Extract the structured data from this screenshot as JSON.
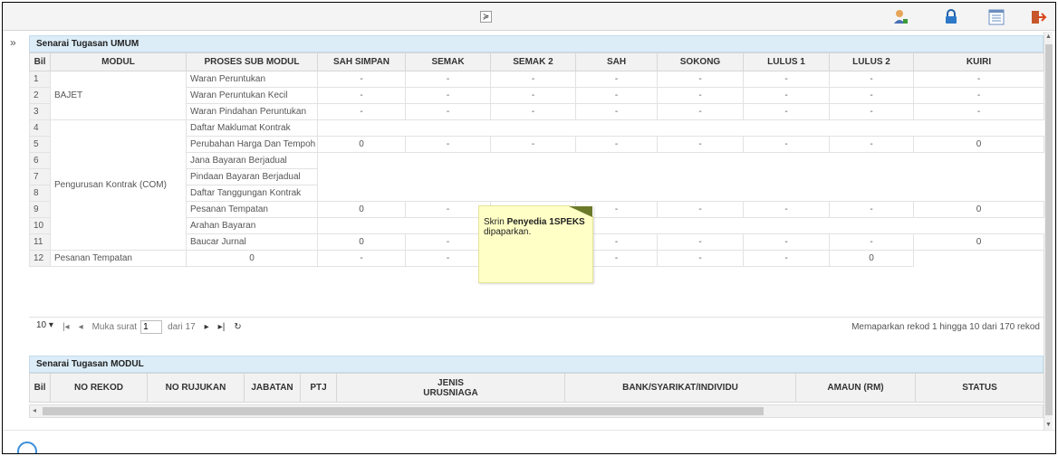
{
  "toolbar": {
    "collapse_glyph": "≽"
  },
  "sidebar": {
    "expand_glyph": "»"
  },
  "umum": {
    "title": "Senarai Tugasan UMUM",
    "headers": [
      "Bil",
      "MODUL",
      "PROSES SUB MODUL",
      "SAH SIMPAN",
      "SEMAK",
      "SEMAK 2",
      "SAH",
      "SOKONG",
      "LULUS 1",
      "LULUS 2",
      "KUIRI"
    ],
    "rows": [
      {
        "bil": "1",
        "proses": "Waran Peruntukan",
        "vals": [
          "-",
          "-",
          "-",
          "-",
          "-",
          "-",
          "-",
          "-"
        ]
      },
      {
        "bil": "2",
        "proses": "Waran Peruntukan Kecil",
        "vals": [
          "-",
          "-",
          "-",
          "-",
          "-",
          "-",
          "-",
          "-"
        ]
      },
      {
        "bil": "3",
        "proses": "Waran Pindahan Peruntukan",
        "vals": [
          "-",
          "-",
          "-",
          "-",
          "-",
          "-",
          "-",
          "-"
        ]
      },
      {
        "bil": "4",
        "proses": "Daftar Maklumat Kontrak"
      },
      {
        "bil": "5",
        "proses": "Perubahan Harga Dan Tempoh Kontrak",
        "vals": [
          "0",
          "-",
          "-",
          "-",
          "-",
          "-",
          "-",
          "0"
        ]
      },
      {
        "bil": "6",
        "proses": "Jana Bayaran Berjadual"
      },
      {
        "bil": "7",
        "proses": "Pindaan Bayaran Berjadual"
      },
      {
        "bil": "8",
        "proses": "Daftar Tanggungan Kontrak"
      },
      {
        "bil": "9",
        "proses": "Pesanan Tempatan",
        "vals": [
          "0",
          "-",
          "",
          "-",
          "-",
          "-",
          "-",
          "0"
        ]
      },
      {
        "bil": "10",
        "proses": "Arahan Bayaran"
      },
      {
        "bil": "11",
        "proses": "Baucar Jurnal",
        "vals": [
          "0",
          "-",
          "-",
          "-",
          "-",
          "-",
          "-",
          "0"
        ]
      },
      {
        "bil": "12",
        "proses": "Pesanan Tempatan",
        "vals": [
          "0",
          "-",
          "-",
          "-",
          "-",
          "-",
          "-",
          "0"
        ]
      }
    ],
    "modul_bajet": "BAJET",
    "modul_kontrak": "Pengurusan Kontrak (COM)"
  },
  "pager": {
    "page_size": "10",
    "page_label": "Muka surat",
    "page_value": "1",
    "of_label": "dari 17",
    "records": "Memaparkan rekod 1 hingga 10 dari 170 rekod"
  },
  "modul": {
    "title": "Senarai Tugasan MODUL",
    "headers": [
      "Bil",
      "NO REKOD",
      "NO RUJUKAN",
      "JABATAN",
      "PTJ",
      "JENIS URUSNIAGA",
      "BANK/SYARIKAT/INDIVIDU",
      "AMAUN (RM)",
      "STATUS"
    ]
  },
  "callout": {
    "prefix": "Skrin ",
    "bold": "Penyedia 1SPEKS",
    "suffix": " dipaparkan."
  },
  "colors": {
    "panel_title_bg": "#dcedf8",
    "callout_bg": "#ffffc6",
    "callout_corner": "#6b7a2a"
  }
}
